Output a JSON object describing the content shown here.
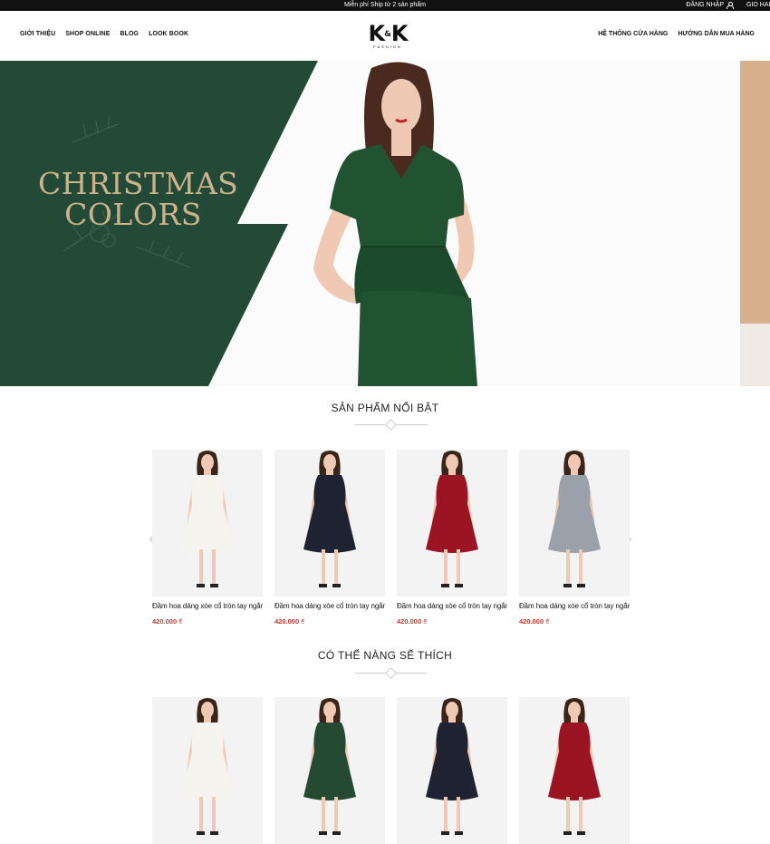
{
  "topbar": {
    "promo": "Miễn phí Ship từ 2 sản phẩm",
    "login": "ĐĂNG NHẬP",
    "cart": "GIỎ HÀNG"
  },
  "nav": {
    "left": [
      "GIỚI THIỆU",
      "SHOP ONLINE",
      "BLOG",
      "LOOK BOOK"
    ],
    "right": [
      "HỆ THỐNG CỬA HÀNG",
      "HƯỚNG DẪN MUA HÀNG"
    ]
  },
  "logo": {
    "mark_left": "K",
    "mark_amp": "&",
    "mark_right": "K",
    "sub": "FASHION"
  },
  "hero": {
    "line1": "CHRISTMAS",
    "line2": "COLORS"
  },
  "featured": {
    "title": "SẢN PHẨM NỔI BẬT",
    "items": [
      {
        "name": "Đầm hoa dáng xòe cổ tròn tay ngắn",
        "price": "420.000 ₫",
        "dress_color": "#f6f4ee"
      },
      {
        "name": "Đầm hoa dáng xòe cổ tròn tay ngắn",
        "price": "420.000 ₫",
        "dress_color": "#1f2230"
      },
      {
        "name": "Đầm hoa dáng xòe cổ tròn tay ngắn",
        "price": "420.000 ₫",
        "dress_color": "#9b1423"
      },
      {
        "name": "Đầm hoa dáng xòe cổ tròn tay ngắn",
        "price": "420.000 ₫",
        "dress_color": "#9aa1ab"
      }
    ]
  },
  "suggested": {
    "title": "CÓ THỂ NÀNG SẼ THÍCH",
    "items": [
      {
        "dress_color": "#f6f4ee"
      },
      {
        "dress_color": "#244a32"
      },
      {
        "dress_color": "#1f2230"
      },
      {
        "dress_color": "#9b1423"
      }
    ]
  },
  "colors": {
    "hero_green": "#234a37",
    "dress_green": "#215333",
    "accent_gold": "#cdb28c",
    "price_red": "#c0392b"
  },
  "icons": {
    "user": "user-icon",
    "prev": "chevron-left-icon",
    "next": "chevron-right-icon"
  }
}
